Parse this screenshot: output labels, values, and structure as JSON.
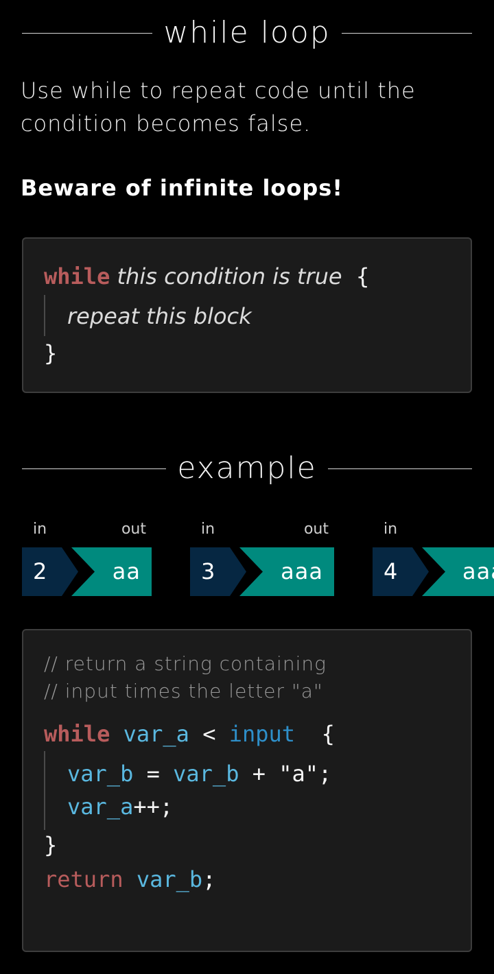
{
  "sections": {
    "while_title": "while loop",
    "example_title": "example"
  },
  "intro": {
    "description": "Use while to repeat code until the condition becomes false.",
    "warning": "Beware of infinite loops!"
  },
  "syntax": {
    "keyword": "while",
    "condition": "this condition is true",
    "open_brace": "{",
    "body": "repeat this block",
    "close_brace": "}"
  },
  "examples": {
    "in_label": "in",
    "out_label": "out",
    "pairs": [
      {
        "in": "2",
        "out": "aa"
      },
      {
        "in": "3",
        "out": "aaa"
      },
      {
        "in": "4",
        "out": "aaaa"
      }
    ]
  },
  "example_code": {
    "comment_1": "// return a string containing",
    "comment_2": "// input times the letter \"a\"",
    "kw_while": "while",
    "var_a": "var_a",
    "lt": " < ",
    "input": "input",
    "open_brace": "{",
    "var_b": "var_b",
    "assign": " = ",
    "plus": " + \"a\";",
    "incr": "++;",
    "close_brace": "}",
    "kw_return": "return",
    "semicolon": ";"
  },
  "colors": {
    "background": "#000000",
    "code_bg": "#1b1b1b",
    "keyword": "#b85c5c",
    "variable": "#5ab8e0",
    "input_out": "#008a7e",
    "input_in": "#062742"
  }
}
